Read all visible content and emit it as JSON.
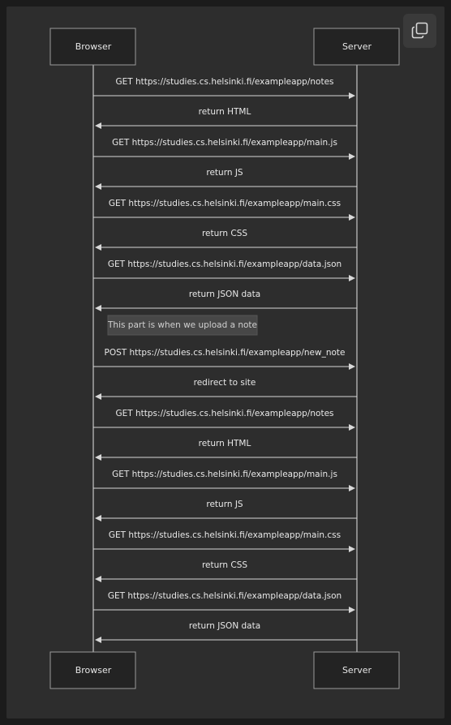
{
  "actors": [
    "Browser",
    "Server"
  ],
  "note": "This part is when we upload a note",
  "messages": [
    {
      "from": "Browser",
      "to": "Server",
      "text": "GET https://studies.cs.helsinki.fi/exampleapp/notes"
    },
    {
      "from": "Server",
      "to": "Browser",
      "text": "return HTML"
    },
    {
      "from": "Browser",
      "to": "Server",
      "text": "GET https://studies.cs.helsinki.fi/exampleapp/main.js"
    },
    {
      "from": "Server",
      "to": "Browser",
      "text": "return JS"
    },
    {
      "from": "Browser",
      "to": "Server",
      "text": "GET https://studies.cs.helsinki.fi/exampleapp/main.css"
    },
    {
      "from": "Server",
      "to": "Browser",
      "text": "return CSS"
    },
    {
      "from": "Browser",
      "to": "Server",
      "text": "GET https://studies.cs.helsinki.fi/exampleapp/data.json"
    },
    {
      "from": "Server",
      "to": "Browser",
      "text": "return JSON data"
    },
    {
      "from": "Browser",
      "to": "Server",
      "text": "POST https://studies.cs.helsinki.fi/exampleapp/new_note"
    },
    {
      "from": "Server",
      "to": "Browser",
      "text": "redirect to site"
    },
    {
      "from": "Browser",
      "to": "Server",
      "text": "GET https://studies.cs.helsinki.fi/exampleapp/notes"
    },
    {
      "from": "Server",
      "to": "Browser",
      "text": "return HTML"
    },
    {
      "from": "Browser",
      "to": "Server",
      "text": "GET https://studies.cs.helsinki.fi/exampleapp/main.js"
    },
    {
      "from": "Server",
      "to": "Browser",
      "text": "return JS"
    },
    {
      "from": "Browser",
      "to": "Server",
      "text": "GET https://studies.cs.helsinki.fi/exampleapp/main.css"
    },
    {
      "from": "Server",
      "to": "Browser",
      "text": "return CSS"
    },
    {
      "from": "Browser",
      "to": "Server",
      "text": "GET https://studies.cs.helsinki.fi/exampleapp/data.json"
    },
    {
      "from": "Server",
      "to": "Browser",
      "text": "return JSON data"
    }
  ],
  "copy_button": {
    "icon": "copy-icon"
  }
}
